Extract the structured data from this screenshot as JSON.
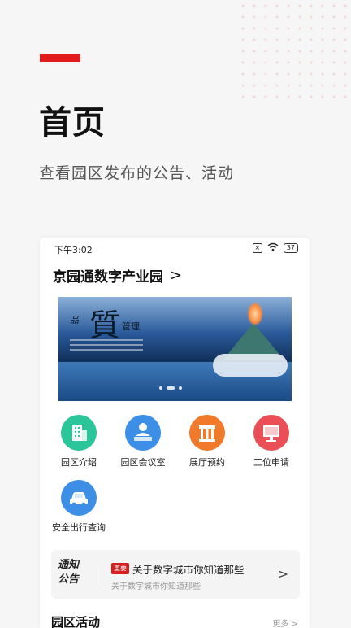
{
  "hero": {
    "title": "首页",
    "subtitle": "查看园区发布的公告、活动"
  },
  "status_bar": {
    "time": "下午3:02",
    "battery": "37"
  },
  "park": {
    "name": "京园通数字产业园"
  },
  "banner": {
    "char_main": "質",
    "char_left": "品",
    "char_right": "管理",
    "page_count": 3,
    "active_index": 1
  },
  "features": [
    {
      "label": "园区介绍",
      "color": "#2bc59a",
      "icon": "building-icon"
    },
    {
      "label": "园区会议室",
      "color": "#3d8ee6",
      "icon": "meeting-room-icon"
    },
    {
      "label": "展厅预约",
      "color": "#f07a2a",
      "icon": "exhibition-hall-icon"
    },
    {
      "label": "工位申请",
      "color": "#ea4f57",
      "icon": "workstation-icon"
    },
    {
      "label": "安全出行查询",
      "color": "#3d8ee6",
      "icon": "car-icon"
    }
  ],
  "notice": {
    "logo_line1": "通知",
    "logo_line2": "公告",
    "badge": "重要",
    "title": "关于数字城市你知道那些",
    "subtitle": "关于数字城市你知道那些"
  },
  "activities": {
    "title": "园区活动",
    "more": "更多 >"
  },
  "colors": {
    "accent": "#e11b1b",
    "badge": "#d81e1e"
  }
}
